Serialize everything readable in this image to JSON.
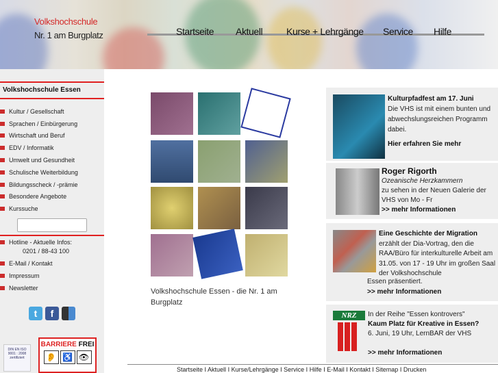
{
  "header": {
    "logo_line1": "Volkshochschule",
    "logo_line2": "Nr. 1 am Burgplatz",
    "nav": [
      {
        "label": "Startseite",
        "color": "#e82a2a"
      },
      {
        "label": "Aktuell",
        "color": "#5a6fd0"
      },
      {
        "label": "Kurse + Lehrgänge",
        "color": "#12b886"
      },
      {
        "label": "Service",
        "color": "#f59a3a"
      },
      {
        "label": "Hilfe",
        "color": "#f5c800"
      }
    ]
  },
  "sidebar": {
    "title": "Volkshochschule Essen",
    "items": [
      "Kultur / Gesellschaft",
      "Sprachen / Einbürgerung",
      "Wirtschaft und Beruf",
      "EDV / Informatik",
      "Umwelt und Gesundheit",
      "Schulische Weiterbildung",
      "Bildungsscheck / -prämie",
      "Besondere Angebote",
      "Kurssuche"
    ],
    "search_value": "",
    "hotline_label": "Hotline - Aktuelle Infos:",
    "hotline_number": "0201 / 88-43 100",
    "links": [
      "E-Mail / Kontakt",
      "Impressum",
      "Newsletter"
    ],
    "iso_badge": "DIN EN ISO 9001 : 2008 zertifiziert",
    "barrier_free": {
      "word1": "BARRIERE",
      "word2": "FREI"
    }
  },
  "main": {
    "caption": "Volkshochschule Essen - die Nr. 1 am Burgplatz"
  },
  "panels": [
    {
      "title": "Kulturpfadfest am 17. Juni",
      "text": "Die VHS ist mit einem bunten und abwechslungsreichen Programm dabei.",
      "link": "Hier erfahren Sie mehr"
    },
    {
      "title": "Roger Rigorth",
      "subtitle": "Ozeanische Herzkammern",
      "text": "zu sehen in der Neuen Galerie der VHS von Mo - Fr",
      "link": ">> mehr Informationen"
    },
    {
      "title": "Eine Geschichte der Migration",
      "text1": "erzählt der Dia-Vortrag, den die RAA/Büro für interkulturelle Arbeit am 31.05. von 17 - 19 Uhr im großen Saal der Volkshochschule",
      "text2": "Essen präsentiert.",
      "link": ">> mehr Informationen"
    },
    {
      "logo": "NRZ",
      "intro": "In der Reihe \"Essen kontrovers\"",
      "title": "Kaum Platz für Kreative in Essen?",
      "text": "6. Juni, 19 Uhr, LernBAR der VHS",
      "link": ">> mehr Informationen"
    }
  ],
  "footer": [
    "Startseite",
    "Aktuell",
    "Kurse/Lehrgänge",
    "Service",
    "Hilfe",
    "E-Mail",
    "Kontakt",
    "Sitemap",
    "Drucken"
  ]
}
